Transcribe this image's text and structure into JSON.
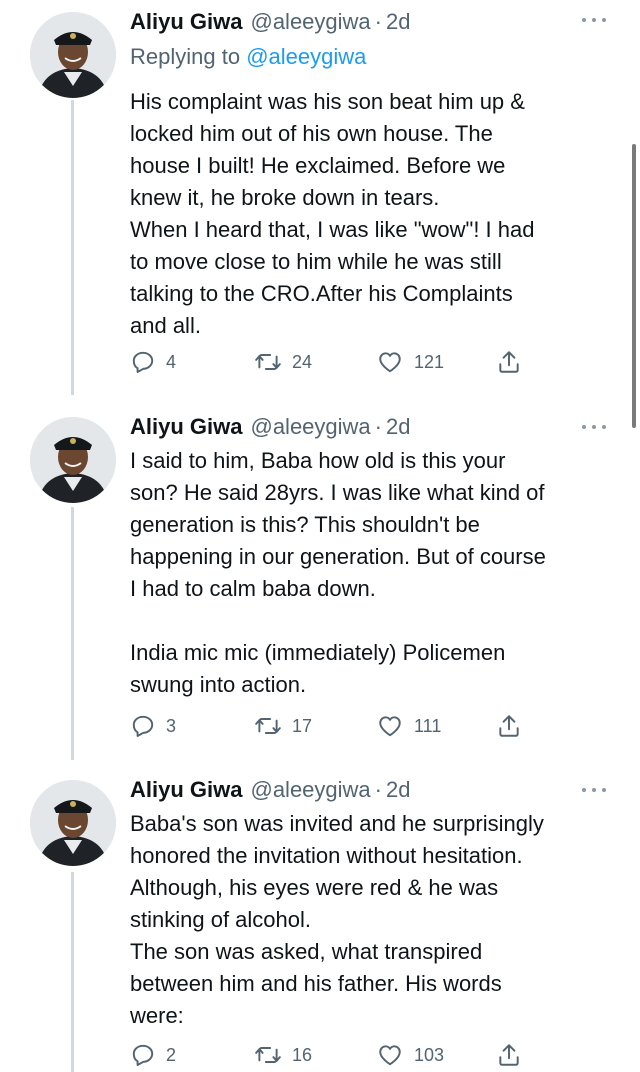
{
  "tweets": [
    {
      "name": "Aliyu Giwa",
      "handle": "@aleeygiwa",
      "time": "2d",
      "replying_prefix": "Replying to ",
      "replying_to": "@aleeygiwa",
      "text": "His complaint was his son beat him up &\nlocked him out of his own house. The\nhouse I built! He exclaimed. Before we\nknew it, he broke down in tears.\nWhen I heard that, I was like \"wow\"! I had\nto move close to him while he was still\ntalking to the CRO.After his Complaints\nand all.",
      "replies": "4",
      "retweets": "24",
      "likes": "121"
    },
    {
      "name": "Aliyu Giwa",
      "handle": "@aleeygiwa",
      "time": "2d",
      "text": "I said to him, Baba how old is this your\nson? He said 28yrs. I was like what kind of\ngeneration is this? This shouldn't be\nhappening in our generation. But of course\nI had to calm baba down.\n\nIndia mic mic (immediately) Policemen\nswung into action.",
      "replies": "3",
      "retweets": "17",
      "likes": "111"
    },
    {
      "name": "Aliyu Giwa",
      "handle": "@aleeygiwa",
      "time": "2d",
      "text": "Baba's son was invited and he surprisingly\nhonored the invitation without hesitation.\nAlthough, his eyes were red & he was\nstinking of alcohol.\nThe son was asked, what transpired\nbetween him and his father. His words\nwere:",
      "replies": "2",
      "retweets": "16",
      "likes": "103"
    }
  ],
  "icons": {
    "reply": "reply-icon",
    "retweet": "retweet-icon",
    "like": "heart-icon",
    "share": "share-icon",
    "more": "more-icon"
  },
  "colors": {
    "link": "#1d9bf0",
    "secondary_text": "#536471",
    "thread_line": "#cfd9de"
  }
}
